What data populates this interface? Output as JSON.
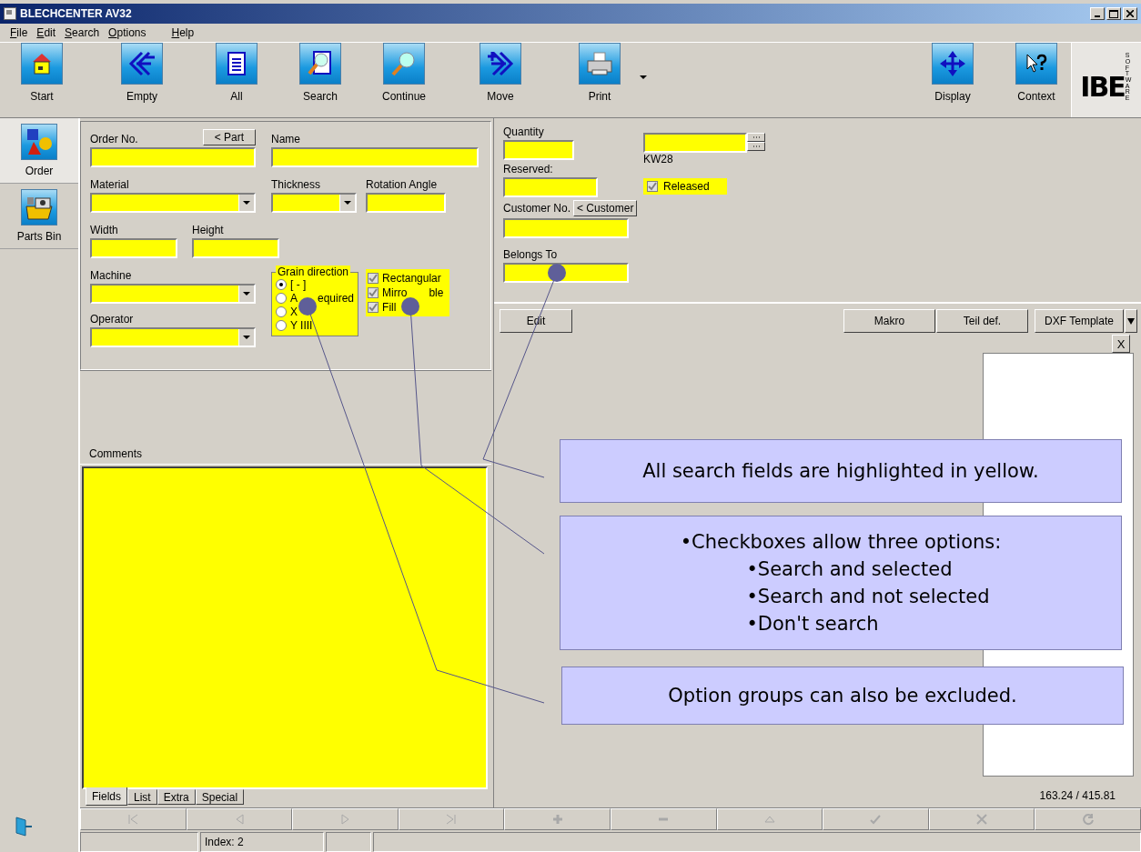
{
  "window": {
    "title": "BLECHCENTER AV32"
  },
  "menu": [
    {
      "label": "File"
    },
    {
      "label": "Edit"
    },
    {
      "label": "Search"
    },
    {
      "label": "Options"
    },
    {
      "label": "Help"
    }
  ],
  "toolbar": [
    {
      "label": "Start"
    },
    {
      "label": "Empty"
    },
    {
      "label": "All"
    },
    {
      "label": "Search"
    },
    {
      "label": "Continue"
    },
    {
      "label": "Move"
    },
    {
      "label": "Print"
    }
  ],
  "toolbar_right": [
    {
      "label": "Display"
    },
    {
      "label": "Context"
    }
  ],
  "logo": {
    "text": "IBE",
    "subtext": "SOFTWARE"
  },
  "sidebar": [
    {
      "label": "Order",
      "selected": true
    },
    {
      "label": "Parts Bin",
      "selected": false
    }
  ],
  "form": {
    "order_no": {
      "label": "Order No.",
      "button": "< Part"
    },
    "name": {
      "label": "Name"
    },
    "material": {
      "label": "Material"
    },
    "thickness": {
      "label": "Thickness"
    },
    "rotation_angle": {
      "label": "Rotation Angle"
    },
    "width": {
      "label": "Width"
    },
    "height": {
      "label": "Height"
    },
    "machine": {
      "label": "Machine"
    },
    "operator": {
      "label": "Operator"
    },
    "grain_direction": {
      "title": "Grain direction",
      "options": [
        {
          "label": "[ - ]",
          "selected": true
        },
        {
          "label": "A",
          "tail": "equired",
          "selected": false
        },
        {
          "label": "X",
          "selected": false
        },
        {
          "label": "Y IIII",
          "selected": false
        }
      ]
    },
    "checkboxes": [
      {
        "label": "Rectangular",
        "checked": true
      },
      {
        "label": "Mirro",
        "tail": "ble",
        "checked": true
      },
      {
        "label": "Fill",
        "checked": true
      }
    ],
    "comments": {
      "label": "Comments"
    }
  },
  "tabs": [
    {
      "label": "Fields",
      "selected": true
    },
    {
      "label": "List",
      "selected": false
    },
    {
      "label": "Extra",
      "selected": false
    },
    {
      "label": "Special",
      "selected": false
    }
  ],
  "details": {
    "quantity": {
      "label": "Quantity"
    },
    "reserved": {
      "label": "Reserved:"
    },
    "customer_no": {
      "label": "Customer No.",
      "button": "< Customer"
    },
    "belongs_to": {
      "label": "Belongs To"
    },
    "week": {
      "text": "KW28"
    },
    "released": {
      "label": "Released",
      "checked": true
    }
  },
  "actions": [
    {
      "label": "Edit",
      "kind": "left"
    },
    {
      "label": "Makro",
      "kind": "right"
    },
    {
      "label": "Teil def.",
      "kind": "right"
    },
    {
      "label": "DXF Template",
      "kind": "dropdown"
    }
  ],
  "close": {
    "label": "X"
  },
  "coordinates": "163.24 / 415.81",
  "status_bar": {
    "index": "Index: 2"
  },
  "callouts": [
    {
      "lines": [
        "All search fields are highlighted in yellow."
      ]
    },
    {
      "lines": [
        "•Checkboxes allow three options:"
      ],
      "items": [
        "•Search and selected",
        "•Search and not selected",
        "•Don't search"
      ]
    },
    {
      "lines": [
        "Option groups can also be excluded."
      ]
    }
  ]
}
